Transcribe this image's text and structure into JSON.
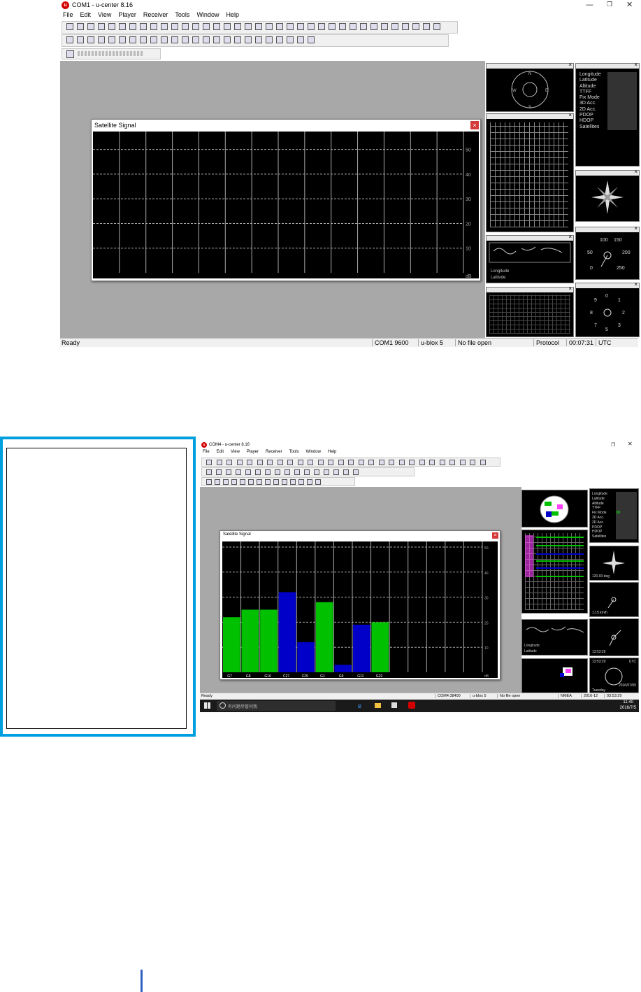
{
  "top": {
    "window_title": "COM1 - u-center 8.16",
    "menus": [
      "File",
      "Edit",
      "View",
      "Player",
      "Receiver",
      "Tools",
      "Window",
      "Help"
    ],
    "dialog_title": "Satellite Signal",
    "chart_data": {
      "type": "bar",
      "title": "Satellite Signal",
      "categories": [],
      "values": [],
      "ylabel": "dB",
      "y_ticks": [
        "50",
        "40",
        "30",
        "20",
        "10"
      ],
      "ylim": [
        0,
        55
      ],
      "grid": true
    },
    "info_labels": [
      "Longitude",
      "Latitude",
      "Altitude",
      "TTFF",
      "Fix Mode",
      "3D Acc.",
      "2D Acc.",
      "PDOP",
      "HDOP",
      "Satellites"
    ],
    "compass_labels": {
      "n": "N",
      "e": "E",
      "s": "S",
      "w": "W"
    },
    "speed_labels": [
      "100",
      "150",
      "50",
      "200",
      "0",
      "250"
    ],
    "map_labels": {
      "lon": "Longitude",
      "lat": "Latitude"
    },
    "status": {
      "ready": "Ready",
      "port": "COM1 9600",
      "device": "u-blox 5",
      "file": "No file open",
      "protocol": "Protocol",
      "time": "00:07:31",
      "tz": "UTC"
    },
    "colors": {
      "mdi_bg": "#a8a8a8",
      "panel_bg": "#000000",
      "accent_red": "#d40000"
    }
  },
  "bottom": {
    "window_title": "COM4 - u-center 8.16",
    "menus": [
      "File",
      "Edit",
      "View",
      "Player",
      "Receiver",
      "Tools",
      "Window",
      "Help"
    ],
    "dialog_title": "Satellite Signal",
    "chart_data": {
      "type": "bar",
      "title": "Satellite Signal",
      "categories": [
        "G7",
        "G8",
        "G16",
        "C27",
        "C29",
        "G1",
        "G9",
        "G11",
        "G22"
      ],
      "series": [
        {
          "values": [
            22,
            25,
            25,
            32,
            12,
            28,
            3,
            19,
            20
          ]
        }
      ],
      "bar_colors": [
        "#00c000",
        "#00c000",
        "#00c000",
        "#0000c8",
        "#0000c8",
        "#00c000",
        "#0000c8",
        "#0000c8",
        "#00c000"
      ],
      "ylabel": "dB",
      "y_ticks": [
        "50",
        "40",
        "30",
        "20",
        "10"
      ],
      "ylim": [
        0,
        50
      ],
      "grid": true
    },
    "info_labels": [
      "Longitude",
      "Latitude",
      "Altitude",
      "TTFF",
      "Fix Mode",
      "3D Acc.",
      "2D Acc.",
      "PDOP",
      "HDOP",
      "Satellites"
    ],
    "info_values": [
      "",
      "",
      "",
      "",
      "3D",
      "",
      "",
      "",
      "",
      ""
    ],
    "compass_readout": "120.93 deg",
    "speed_readout": "1.15 km/h",
    "time_readout": "13:53:29",
    "time_tz": "UTC",
    "clock_label": "Tuesday",
    "clock_date": "2016/07/05",
    "map_labels": {
      "lon": "Longitude",
      "lat": "Latitude"
    },
    "status": {
      "ready": "Ready",
      "port": "COM4 38400",
      "device": "u-blox 5",
      "file": "No file open",
      "protocol": "NMEA",
      "date": "2016-12",
      "time": "03:53:29"
    },
    "taskbar": {
      "search_placeholder": "有问题尽管问我",
      "clock_time": "11:40",
      "clock_date": "2016/7/5"
    },
    "colors": {
      "frame_blue": "#00a0e0",
      "bar_green": "#00c000",
      "bar_blue": "#0000c8"
    }
  },
  "footer": {
    "marker_color": "#3060c0"
  }
}
